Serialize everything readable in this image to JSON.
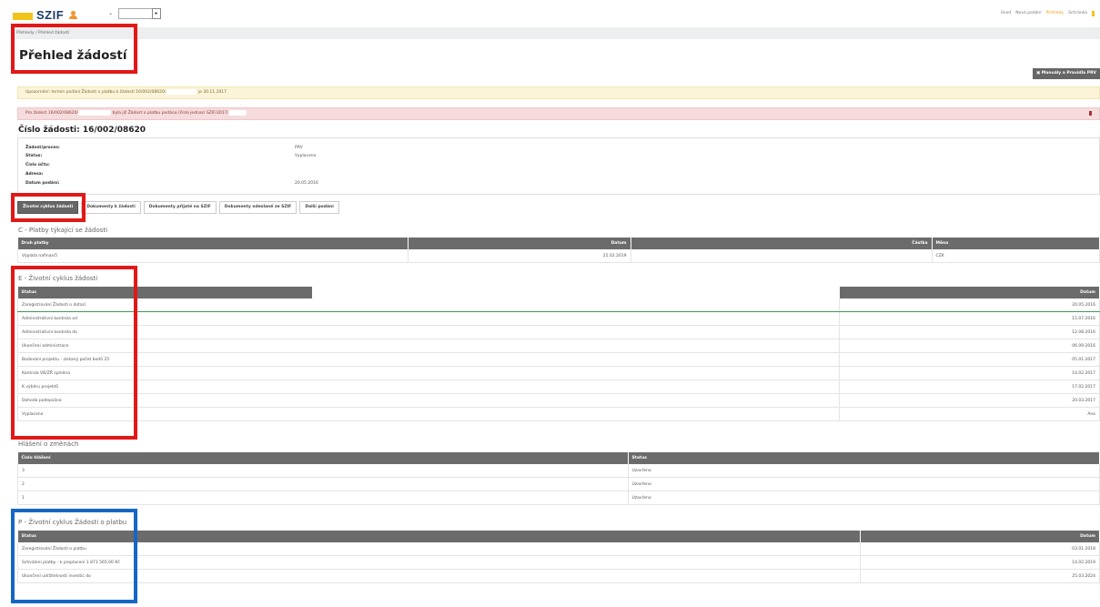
{
  "header": {
    "logo_text": "SZIF",
    "select_arrow": "⌄",
    "go_icon": "▸",
    "nav": [
      "Úvod",
      "Nová podání",
      "Přehledy",
      "Schránka"
    ],
    "nav_active_index": 2,
    "accent_color": "#e8a31b"
  },
  "breadcrumb": "Přehledy  /  Přehled žádostí",
  "page_title": "Přehled žádostí",
  "manual_button": "Manuály a Pravidla PRV",
  "alerts": {
    "yellow_before": "Upozornění: termín podání Žádosti o platbu k žádosti 16/002/08620/",
    "yellow_after": "je 30.11.2017",
    "red_before": "Pro žádost 16/002/08620/",
    "red_after": "byla již Žádost o platbu podána (číslo jednací SZIF/2017/"
  },
  "application": {
    "title": "Číslo žádosti: 16/002/08620",
    "fields": [
      {
        "label": "Žádost/proces:",
        "value": "PRV"
      },
      {
        "label": "Status:",
        "value": "Vyplaceno"
      },
      {
        "label": "Číslo účtu:",
        "value": ""
      },
      {
        "label": "Adresa:",
        "value": ""
      },
      {
        "label": "Datum podání:",
        "value": "20.05.2016"
      }
    ]
  },
  "tabs": [
    "Životní cyklus žádosti",
    "Dokumenty k žádosti",
    "Dokumenty přijaté na SZIF",
    "Dokumenty odeslané ze SZIF",
    "Další podání"
  ],
  "payments": {
    "title": "C - Platby týkající se žádosti",
    "headers": [
      "Druh platby",
      "Datum",
      "Částka",
      "Měna"
    ],
    "rows": [
      [
        "Výplata nafinančí",
        "25.02.2019",
        "",
        "CZK"
      ]
    ]
  },
  "lifecycle": {
    "title": "E - Životní cyklus žádosti",
    "headers": [
      "Status",
      "",
      "Datum"
    ],
    "rows": [
      [
        "Zaregistrování Žádosti o dotaci",
        "20.05.2016"
      ],
      [
        "Administrativní kontrola od",
        "15.07.2016"
      ],
      [
        "Administrativní kontrola do",
        "12.08.2016"
      ],
      [
        "Ukončení administrace",
        "06.09.2016"
      ],
      [
        "Bodování projektu - získaný počet bodů 25",
        "05.01.2017"
      ],
      [
        "Kontrola VB/ZŘ splněna",
        "14.02.2017"
      ],
      [
        "K výběru projektů",
        "17.02.2017"
      ],
      [
        "Dohoda podepsána",
        "20.03.2017"
      ],
      [
        "Vyplaceno",
        "Ano"
      ]
    ]
  },
  "changes": {
    "title": "Hlášení o změnách",
    "headers": [
      "Číslo hlášení",
      "Status"
    ],
    "rows": [
      [
        "3",
        "Uzavřeno"
      ],
      [
        "2",
        "Uzavřeno"
      ],
      [
        "1",
        "Uzavřeno"
      ]
    ]
  },
  "payment_lifecycle": {
    "title": "P - Životní cyklus Žádosti o platbu",
    "headers": [
      "Status",
      "Datum"
    ],
    "rows": [
      [
        "Zaregistrování Žádosti o platbu",
        "03.01.2018"
      ],
      [
        "Schválení platby - k proplacení 1 871 565,00 Kč",
        "14.02.2019"
      ],
      [
        "Ukončení udržitelnosti investic do",
        "25.03.2024"
      ]
    ]
  }
}
